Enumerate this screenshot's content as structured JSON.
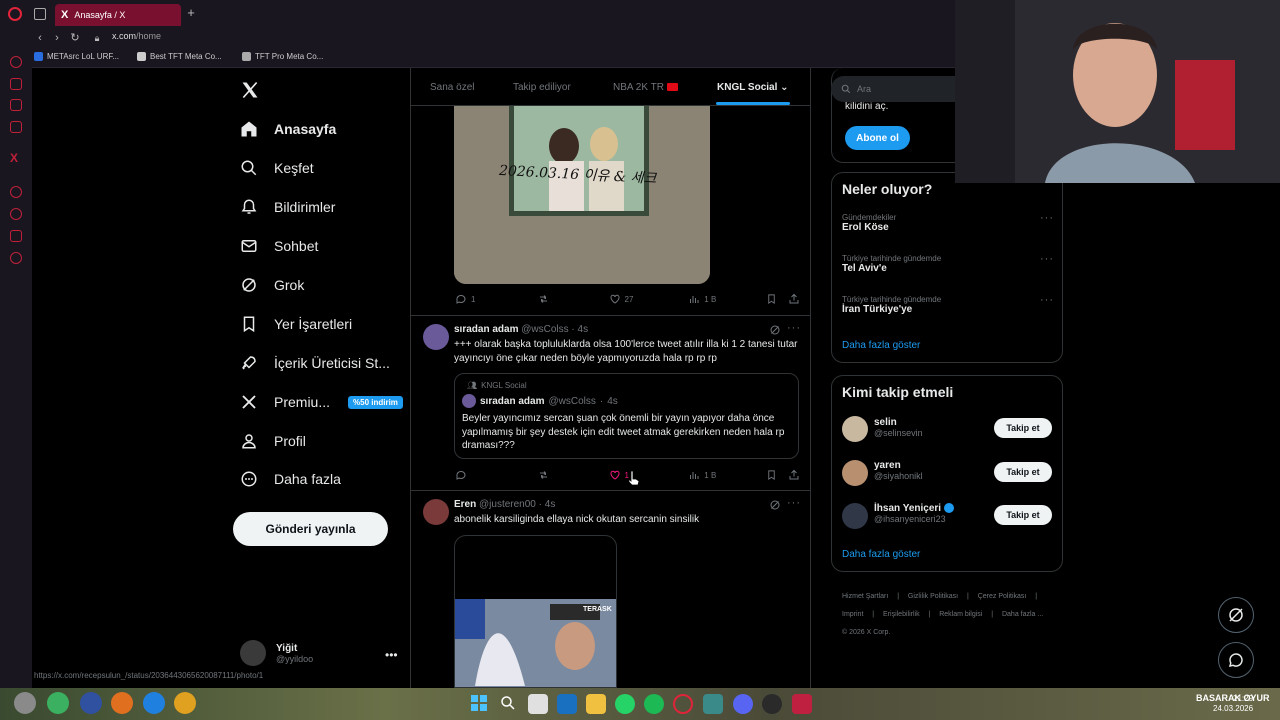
{
  "browser": {
    "tab_title": "Anasayfa / X",
    "tab_x": "X",
    "url_host": "x.com",
    "url_path": "/home",
    "bookmarks": [
      "METAsrc LoL URF...",
      "Best TFT Meta Co...",
      "TFT Pro Meta Co..."
    ],
    "status_url": "https://x.com/recepsulun_/status/2036443065620087111/photo/1"
  },
  "nav": {
    "home": "Anasayfa",
    "explore": "Keşfet",
    "notifications": "Bildirimler",
    "messages": "Sohbet",
    "grok": "Grok",
    "bookmarks": "Yer İşaretleri",
    "creator": "İçerik Üreticisi St...",
    "premium": "Premiu...",
    "premium_badge": "%50 indirim",
    "profile": "Profil",
    "more": "Daha fazla",
    "post_button": "Gönderi yayınla"
  },
  "account": {
    "name": "Yiğit",
    "handle": "@yyildoo"
  },
  "feed_tabs": [
    "Sana özel",
    "Takip ediliyor",
    "NBA 2K TR",
    "KNGL Social"
  ],
  "tweets": [
    {
      "photo_caption": "2026.03.16 이유 & 세크",
      "replies": "1",
      "likes": "27",
      "views": "1 B"
    },
    {
      "name": "sıradan adam",
      "handle": "@wsColss",
      "time": "4s",
      "text": "+++ olarak başka topluluklarda olsa 100'lerce tweet atılır illa ki 1 2 tanesi tutar yayıncıyı öne çıkar neden böyle yapmıyoruzda hala rp rp rp",
      "quote_community": "KNGL Social",
      "quote_name": "sıradan adam",
      "quote_handle": "@wsColss",
      "quote_time": "4s",
      "quote_text": "Beyler yayıncımız sercan şuan çok önemli bir yayın yapıyor daha önce yapılmamış bir şey destek için edit tweet atmak gerekirken neden hala rp draması???",
      "likes": "1",
      "views": "1 B"
    },
    {
      "name": "Eren",
      "handle": "@justeren00",
      "time": "4s",
      "text": "abonelik karsiliginda ellaya nick okutan sercanin sinsilik",
      "video_label": "TERASK"
    }
  ],
  "right": {
    "search_placeholder": "Ara",
    "sub_text": "kilidini aç.",
    "sub_button": "Abone ol",
    "trends_title": "Neler oluyor?",
    "trends": [
      {
        "meta": "Gündemdekiler",
        "name": "Erol Köse"
      },
      {
        "meta": "Türkiye tarihinde gündemde",
        "name": "Tel Aviv'e"
      },
      {
        "meta": "Türkiye tarihinde gündemde",
        "name": "İran Türkiye'ye"
      }
    ],
    "show_more": "Daha fazla göster",
    "follow_title": "Kimi takip etmeli",
    "follow": [
      {
        "name": "selin",
        "handle": "@selinsevin",
        "button": "Takip et",
        "color": "#c8b8a0"
      },
      {
        "name": "yaren",
        "handle": "@siyahonikl",
        "button": "Takip et",
        "color": "#b89070"
      },
      {
        "name": "İhsan Yeniçeri",
        "handle": "@ihsanyeniceri23",
        "button": "Takip et",
        "color": "#303848"
      }
    ],
    "follow_more": "Daha fazla göster",
    "footer": [
      "Hizmet Şartları",
      "|",
      "Gizlilik Politikası",
      "|",
      "Çerez Politikası",
      "|",
      "Imprint",
      "|",
      "Erişilebilirlik",
      "|",
      "Reklam bilgisi",
      "|",
      "Daha fazla ...",
      "© 2026 X Corp."
    ]
  },
  "taskbar": {
    "time": "21:29",
    "date": "24.03.2026",
    "tray": "BASARAK OYUR"
  },
  "colors": {
    "accent": "#1d9bf0",
    "like": "#f91880",
    "opera": "#e0243a"
  }
}
